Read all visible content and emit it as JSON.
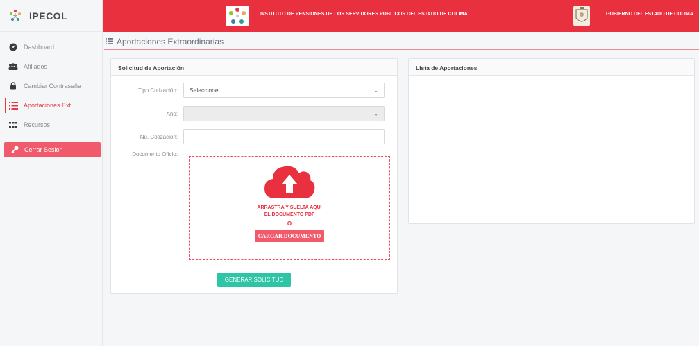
{
  "brand": {
    "name": "IPECOL",
    "logo_icon": "ipecol-logo-icon"
  },
  "sidebar": {
    "items": [
      {
        "label": "Dashboard",
        "icon": "dashboard-icon"
      },
      {
        "label": "Afiliados",
        "icon": "users-icon"
      },
      {
        "label": "Cambiar Contraseña",
        "icon": "lock-icon"
      },
      {
        "label": "Aportaciones Ext.",
        "icon": "list-icon",
        "active": true
      },
      {
        "label": "Recursos",
        "icon": "grid-icon"
      }
    ],
    "logout_label": "Cerrar Sesión"
  },
  "topbar": {
    "institute": "INSTITUTO DE PENSIONES DE LOS SERVIDORES PUBLICOS DEL ESTADO DE COLIMA",
    "government": "GOBIERNO DEL ESTADO DE COLIMA",
    "background": "#e8303f"
  },
  "page": {
    "title": "Aportaciones Extraordinarias"
  },
  "form": {
    "header": "Solicitud de Aportación",
    "tipo_label": "Tipo Cotización:",
    "tipo_value": "Seleccione...",
    "anio_label": "Año:",
    "anio_value": "",
    "num_label": "Nú. Cotización:",
    "num_value": "",
    "doc_label": "Documento Oficio:",
    "drop_line1": "ARRASTRA Y SUELTA AQUI",
    "drop_line2": "EL DOCUMENTO PDF",
    "drop_or": "O",
    "upload_button": "CARGAR DOCUMENTO",
    "generate_button": "GENERAR SOLICITUD"
  },
  "list": {
    "header": "Lista de Aportaciones"
  },
  "colors": {
    "accent": "#e8303f",
    "success": "#2ec4a6",
    "logout": "#f05a6b"
  }
}
